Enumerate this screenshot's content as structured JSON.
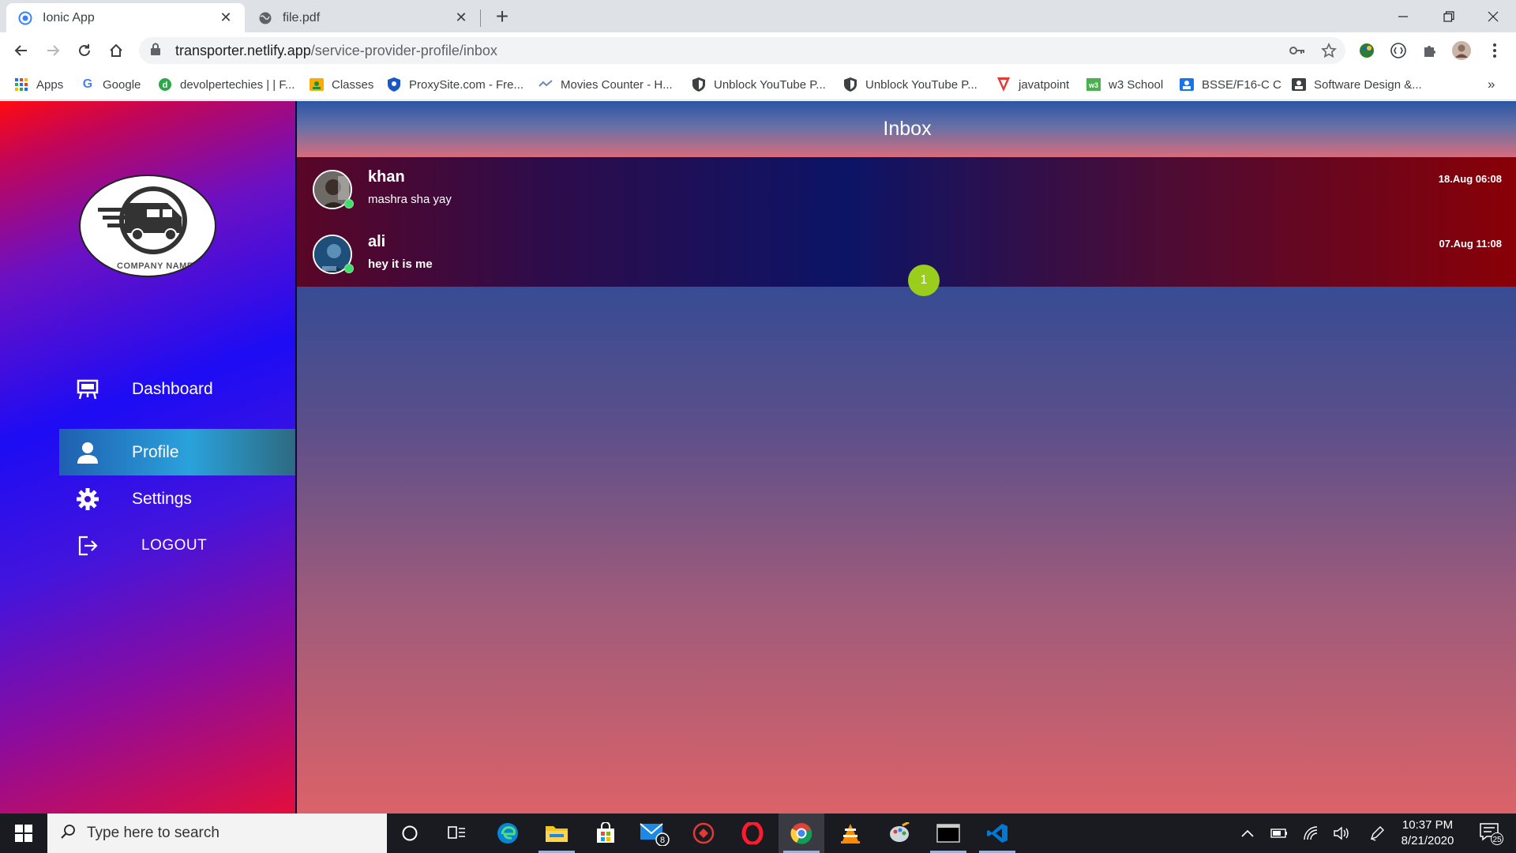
{
  "browser": {
    "tabs": [
      {
        "title": "Ionic App",
        "active": true
      },
      {
        "title": "file.pdf",
        "active": false
      }
    ],
    "url_host": "transporter.netlify.app",
    "url_path": "/service-provider-profile/inbox",
    "bookmarks": [
      {
        "label": "Apps",
        "icon": "apps-grid-icon"
      },
      {
        "label": "Google",
        "icon": "google-icon"
      },
      {
        "label": "devolpertechies | | F...",
        "icon": "devolpertechies-icon"
      },
      {
        "label": "Classes",
        "icon": "classroom-icon"
      },
      {
        "label": "ProxySite.com - Fre...",
        "icon": "proxysite-icon"
      },
      {
        "label": "Movies Counter - H...",
        "icon": "movies-counter-icon"
      },
      {
        "label": "Unblock YouTube P...",
        "icon": "shield-icon"
      },
      {
        "label": "Unblock YouTube P...",
        "icon": "shield-icon"
      },
      {
        "label": "javatpoint",
        "icon": "javatpoint-icon"
      },
      {
        "label": "w3 School",
        "icon": "w3school-icon"
      },
      {
        "label": "BSSE/F16-C C",
        "icon": "classroom-user-icon"
      },
      {
        "label": "Software Design &...",
        "icon": "classroom-user-icon"
      }
    ],
    "more_bookmarks": "»"
  },
  "sidebar": {
    "logo_text": "COMPANY NAME",
    "items": [
      {
        "label": "Dashboard",
        "icon": "dashboard-icon",
        "active": false
      },
      {
        "label": "Profile",
        "icon": "person-icon",
        "active": true
      },
      {
        "label": "Settings",
        "icon": "gear-icon",
        "active": false
      },
      {
        "label": "LOGOUT",
        "icon": "logout-icon",
        "active": false
      }
    ]
  },
  "main": {
    "title": "Inbox",
    "conversations": [
      {
        "name": "khan",
        "message": "mashra sha yay",
        "time": "18.Aug 06:08",
        "online": true,
        "unread": null
      },
      {
        "name": "ali",
        "message": "hey it is me",
        "time": "07.Aug 11:08",
        "online": true,
        "unread": "1"
      }
    ]
  },
  "taskbar": {
    "search_placeholder": "Type here to search",
    "mail_badge": "8",
    "time": "10:37 PM",
    "date": "8/21/2020",
    "notifications": "25"
  },
  "colors": {
    "badge": "#9acd1c",
    "online": "#3fe06a",
    "active_menu": "#2aa2dc"
  }
}
